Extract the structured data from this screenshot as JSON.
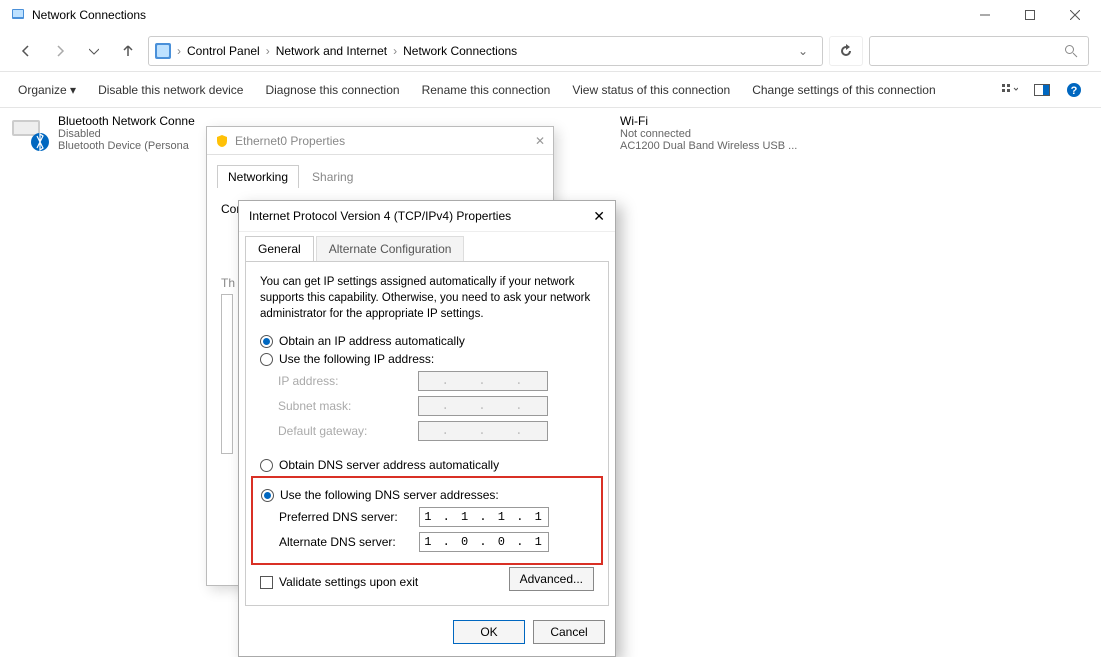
{
  "window": {
    "title": "Network Connections"
  },
  "breadcrumb": {
    "root_icon": "control-panel",
    "items": [
      "Control Panel",
      "Network and Internet",
      "Network Connections"
    ]
  },
  "commands": {
    "organize": "Organize",
    "items": [
      "Disable this network device",
      "Diagnose this connection",
      "Rename this connection",
      "View status of this connection",
      "Change settings of this connection"
    ]
  },
  "connections": [
    {
      "name": "Bluetooth Network Conne",
      "status": "Disabled",
      "device": "Bluetooth Device (Persona"
    },
    {
      "name": "Wi-Fi",
      "status": "Not connected",
      "device": "AC1200 Dual Band Wireless USB ..."
    }
  ],
  "eth_dialog": {
    "title": "Ethernet0 Properties",
    "tabs": [
      "Networking",
      "Sharing"
    ],
    "connect_label": "Connect using:",
    "items_label": "This connection uses the following items:"
  },
  "tcp_dialog": {
    "title": "Internet Protocol Version 4 (TCP/IPv4) Properties",
    "tabs": [
      "General",
      "Alternate Configuration"
    ],
    "desc": "You can get IP settings assigned automatically if your network supports this capability. Otherwise, you need to ask your network administrator for the appropriate IP settings.",
    "ip_auto": "Obtain an IP address automatically",
    "ip_manual": "Use the following IP address:",
    "ip_address_label": "IP address:",
    "subnet_label": "Subnet mask:",
    "gateway_label": "Default gateway:",
    "dns_auto": "Obtain DNS server address automatically",
    "dns_manual": "Use the following DNS server addresses:",
    "pref_dns_label": "Preferred DNS server:",
    "alt_dns_label": "Alternate DNS server:",
    "pref_dns_value": "1 . 1 . 1 . 1",
    "alt_dns_value": "1 . 0 . 0 . 1",
    "validate": "Validate settings upon exit",
    "advanced": "Advanced...",
    "ok": "OK",
    "cancel": "Cancel"
  }
}
